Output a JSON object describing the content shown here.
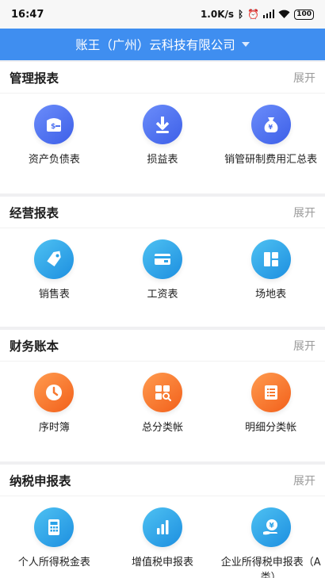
{
  "status": {
    "time": "16:47",
    "speed": "1.0K/s",
    "battery": "100"
  },
  "header": {
    "company": "账王（广州）云科技有限公司"
  },
  "sections": [
    {
      "title": "管理报表",
      "expand": "展开",
      "items": [
        {
          "label": "资产负债表",
          "icon": "money-card-icon"
        },
        {
          "label": "损益表",
          "icon": "download-icon"
        },
        {
          "label": "销管研制费用汇总表",
          "icon": "money-bag-icon"
        }
      ]
    },
    {
      "title": "经营报表",
      "expand": "展开",
      "items": [
        {
          "label": "销售表",
          "icon": "tag-icon"
        },
        {
          "label": "工资表",
          "icon": "bank-card-icon"
        },
        {
          "label": "场地表",
          "icon": "layout-icon"
        }
      ]
    },
    {
      "title": "财务账本",
      "expand": "展开",
      "items": [
        {
          "label": "序时簿",
          "icon": "clock-icon"
        },
        {
          "label": "总分类帐",
          "icon": "grid-search-icon"
        },
        {
          "label": "明细分类帐",
          "icon": "list-icon"
        }
      ]
    },
    {
      "title": "纳税申报表",
      "expand": "展开",
      "items": [
        {
          "label": "个人所得税金表",
          "icon": "calculator-icon"
        },
        {
          "label": "增值税申报表",
          "icon": "bar-chart-icon"
        },
        {
          "label": "企业所得税申报表（A类）",
          "icon": "yuan-hand-icon"
        }
      ]
    }
  ],
  "colors": {
    "header": "#3f8ef0",
    "indigo": "#4f72f0",
    "blue": "#2aa2e8",
    "orange": "#f7782f"
  }
}
